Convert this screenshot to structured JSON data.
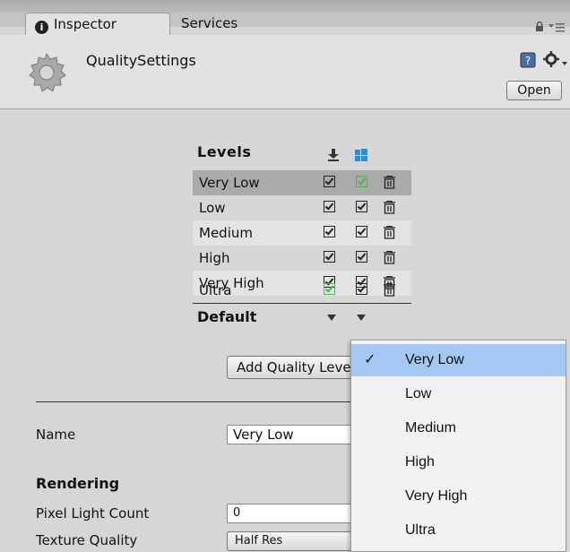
{
  "tabs": {
    "inspector": "Inspector",
    "services": "Services"
  },
  "header": {
    "title": "QualitySettings",
    "open_button": "Open"
  },
  "levels": {
    "header": "Levels",
    "rows": [
      {
        "label": "Very Low",
        "selected": true
      },
      {
        "label": "Low"
      },
      {
        "label": "Medium"
      },
      {
        "label": "High"
      },
      {
        "label": "Very High"
      },
      {
        "label": "Ultra"
      }
    ],
    "default_label": "Default",
    "add_button": "Add Quality Level"
  },
  "properties": {
    "name_label": "Name",
    "name_value": "Very Low",
    "rendering_heading": "Rendering",
    "pixel_light_label": "Pixel Light Count",
    "pixel_light_value": "0",
    "texture_quality_label": "Texture Quality",
    "texture_quality_value": "Half Res"
  },
  "dropdown": {
    "items": [
      "Very Low",
      "Low",
      "Medium",
      "High",
      "Very High",
      "Ultra"
    ],
    "selected": "Very Low"
  },
  "icons": {
    "lock": "lock-icon",
    "menu": "tab-menu-icon",
    "help": "help-icon",
    "settings": "gear-icon",
    "download": "download-icon",
    "windows": "windows-icon",
    "trash": "trash-icon"
  },
  "colors": {
    "panel_bg": "#d6d6d6",
    "selected_row": "#aaaaaa",
    "dropdown_highlight": "#a5c8f2",
    "checkbox_green": "#46b946",
    "windows_blue": "#1e90e8"
  }
}
